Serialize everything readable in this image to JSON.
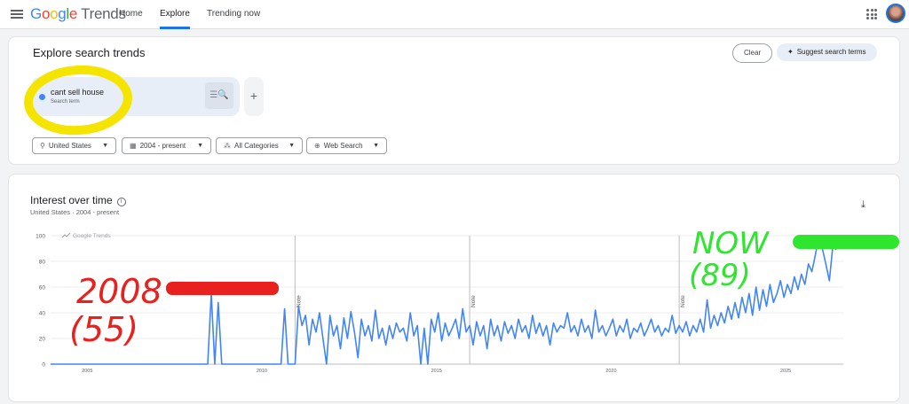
{
  "header": {
    "logo_google": "Google",
    "logo_trends": "Trends",
    "nav": {
      "home": "Home",
      "explore": "Explore",
      "trending": "Trending now"
    },
    "icons": {
      "menu": "menu-icon",
      "apps": "apps-grid-icon",
      "avatar": "user-avatar"
    }
  },
  "explore": {
    "title": "Explore search trends",
    "clear_label": "Clear",
    "suggest_label": "Suggest search terms",
    "term": {
      "name": "cant sell house",
      "type": "Search term",
      "color": "#4285f4"
    },
    "add_label": "+",
    "filters": {
      "region": "United States",
      "time": "2004 - present",
      "category": "All Categories",
      "property": "Web Search"
    }
  },
  "chart_data": {
    "type": "line",
    "title": "Interest over time",
    "subtitle": "United States · 2004 - present",
    "watermark": "Google Trends",
    "y_ticks": [
      0,
      20,
      40,
      60,
      80,
      100
    ],
    "x_ticks": [
      "2005",
      "2010",
      "2015",
      "2020",
      "2025"
    ],
    "ylim": [
      0,
      100
    ],
    "xlim": [
      2004,
      2026.7
    ],
    "notes": [
      {
        "x": 2011.0,
        "label": "Note"
      },
      {
        "x": 2016.0,
        "label": "Note"
      },
      {
        "x": 2022.0,
        "label": "Note"
      }
    ],
    "series": [
      {
        "color": "#4285f4",
        "points": [
          [
            2004.0,
            0
          ],
          [
            2008.5,
            0
          ],
          [
            2008.6,
            55
          ],
          [
            2008.7,
            0
          ],
          [
            2008.8,
            48
          ],
          [
            2008.9,
            0
          ],
          [
            2010.6,
            0
          ],
          [
            2010.7,
            43
          ],
          [
            2010.8,
            0
          ],
          [
            2011.0,
            0
          ],
          [
            2011.1,
            45
          ],
          [
            2011.2,
            30
          ],
          [
            2011.3,
            38
          ],
          [
            2011.4,
            15
          ],
          [
            2011.5,
            35
          ],
          [
            2011.6,
            25
          ],
          [
            2011.7,
            40
          ],
          [
            2011.8,
            20
          ],
          [
            2011.9,
            0
          ],
          [
            2012.0,
            38
          ],
          [
            2012.1,
            22
          ],
          [
            2012.2,
            30
          ],
          [
            2012.3,
            12
          ],
          [
            2012.4,
            36
          ],
          [
            2012.5,
            20
          ],
          [
            2012.6,
            41
          ],
          [
            2012.7,
            25
          ],
          [
            2012.8,
            5
          ],
          [
            2012.9,
            35
          ],
          [
            2013.0,
            22
          ],
          [
            2013.1,
            30
          ],
          [
            2013.2,
            18
          ],
          [
            2013.3,
            42
          ],
          [
            2013.4,
            20
          ],
          [
            2013.5,
            28
          ],
          [
            2013.6,
            15
          ],
          [
            2013.7,
            30
          ],
          [
            2013.8,
            20
          ],
          [
            2013.9,
            32
          ],
          [
            2014.0,
            25
          ],
          [
            2014.1,
            28
          ],
          [
            2014.2,
            18
          ],
          [
            2014.3,
            40
          ],
          [
            2014.4,
            22
          ],
          [
            2014.5,
            30
          ],
          [
            2014.6,
            0
          ],
          [
            2014.7,
            28
          ],
          [
            2014.8,
            0
          ],
          [
            2014.9,
            35
          ],
          [
            2015.0,
            25
          ],
          [
            2015.1,
            40
          ],
          [
            2015.2,
            18
          ],
          [
            2015.3,
            32
          ],
          [
            2015.4,
            22
          ],
          [
            2015.5,
            28
          ],
          [
            2015.6,
            35
          ],
          [
            2015.7,
            20
          ],
          [
            2015.8,
            43
          ],
          [
            2015.9,
            25
          ],
          [
            2016.0,
            30
          ],
          [
            2016.1,
            15
          ],
          [
            2016.2,
            33
          ],
          [
            2016.3,
            22
          ],
          [
            2016.4,
            30
          ],
          [
            2016.5,
            12
          ],
          [
            2016.6,
            35
          ],
          [
            2016.7,
            22
          ],
          [
            2016.8,
            30
          ],
          [
            2016.9,
            18
          ],
          [
            2017.0,
            33
          ],
          [
            2017.1,
            24
          ],
          [
            2017.2,
            30
          ],
          [
            2017.3,
            20
          ],
          [
            2017.4,
            35
          ],
          [
            2017.5,
            25
          ],
          [
            2017.6,
            30
          ],
          [
            2017.7,
            20
          ],
          [
            2017.8,
            38
          ],
          [
            2017.9,
            24
          ],
          [
            2018.0,
            32
          ],
          [
            2018.1,
            22
          ],
          [
            2018.2,
            30
          ],
          [
            2018.3,
            15
          ],
          [
            2018.4,
            32
          ],
          [
            2018.5,
            25
          ],
          [
            2018.6,
            30
          ],
          [
            2018.7,
            28
          ],
          [
            2018.8,
            40
          ],
          [
            2018.9,
            25
          ],
          [
            2019.0,
            30
          ],
          [
            2019.1,
            22
          ],
          [
            2019.2,
            35
          ],
          [
            2019.3,
            25
          ],
          [
            2019.4,
            30
          ],
          [
            2019.5,
            20
          ],
          [
            2019.6,
            42
          ],
          [
            2019.7,
            25
          ],
          [
            2019.8,
            30
          ],
          [
            2019.9,
            22
          ],
          [
            2020.0,
            28
          ],
          [
            2020.1,
            35
          ],
          [
            2020.2,
            22
          ],
          [
            2020.3,
            30
          ],
          [
            2020.4,
            25
          ],
          [
            2020.5,
            35
          ],
          [
            2020.6,
            20
          ],
          [
            2020.7,
            28
          ],
          [
            2020.8,
            25
          ],
          [
            2020.9,
            32
          ],
          [
            2021.0,
            22
          ],
          [
            2021.1,
            28
          ],
          [
            2021.2,
            35
          ],
          [
            2021.3,
            25
          ],
          [
            2021.4,
            30
          ],
          [
            2021.5,
            22
          ],
          [
            2021.6,
            28
          ],
          [
            2021.7,
            25
          ],
          [
            2021.8,
            38
          ],
          [
            2021.9,
            24
          ],
          [
            2022.0,
            30
          ],
          [
            2022.1,
            25
          ],
          [
            2022.2,
            33
          ],
          [
            2022.3,
            22
          ],
          [
            2022.4,
            30
          ],
          [
            2022.5,
            25
          ],
          [
            2022.6,
            35
          ],
          [
            2022.7,
            25
          ],
          [
            2022.8,
            50
          ],
          [
            2022.9,
            28
          ],
          [
            2023.0,
            38
          ],
          [
            2023.1,
            30
          ],
          [
            2023.2,
            40
          ],
          [
            2023.3,
            32
          ],
          [
            2023.4,
            45
          ],
          [
            2023.5,
            35
          ],
          [
            2023.6,
            48
          ],
          [
            2023.7,
            36
          ],
          [
            2023.8,
            52
          ],
          [
            2023.9,
            40
          ],
          [
            2024.0,
            55
          ],
          [
            2024.1,
            38
          ],
          [
            2024.2,
            60
          ],
          [
            2024.3,
            42
          ],
          [
            2024.4,
            58
          ],
          [
            2024.5,
            45
          ],
          [
            2024.6,
            62
          ],
          [
            2024.7,
            48
          ],
          [
            2024.8,
            55
          ],
          [
            2024.9,
            65
          ],
          [
            2025.0,
            52
          ],
          [
            2025.1,
            62
          ],
          [
            2025.2,
            55
          ],
          [
            2025.3,
            68
          ],
          [
            2025.4,
            58
          ],
          [
            2025.5,
            70
          ],
          [
            2025.6,
            62
          ],
          [
            2025.7,
            78
          ],
          [
            2025.8,
            72
          ],
          [
            2025.9,
            85
          ],
          [
            2026.0,
            100
          ],
          [
            2026.1,
            90
          ],
          [
            2026.2,
            78
          ],
          [
            2026.3,
            65
          ],
          [
            2026.4,
            92
          ],
          [
            2026.5,
            89
          ]
        ]
      }
    ]
  },
  "annotations": {
    "left_text_1": "2008",
    "left_text_2": "(55)",
    "right_text_1": "NOW",
    "right_text_2": "(89)",
    "red_color": "#e8201e",
    "green_color": "#2ee62e",
    "yellow_color": "#f5e400"
  }
}
